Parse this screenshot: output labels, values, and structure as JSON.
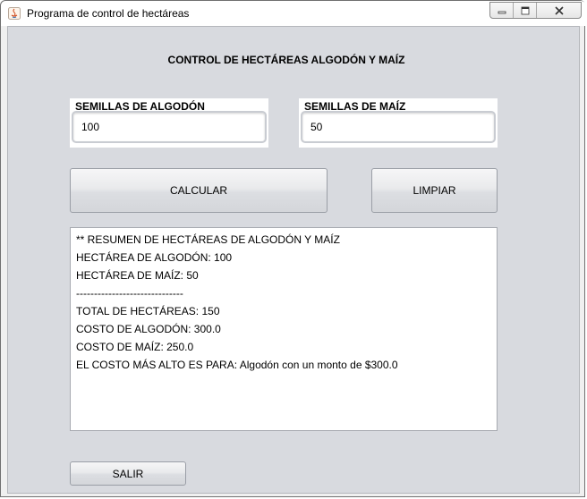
{
  "window": {
    "title": "Programa de control de hectáreas"
  },
  "heading": "CONTROL DE HECTÁREAS ALGODÓN Y MAÍZ",
  "fields": {
    "algodon": {
      "label": "SEMILLAS DE ALGODÓN",
      "value": "100"
    },
    "maiz": {
      "label": "SEMILLAS DE MAÍZ",
      "value": "50"
    }
  },
  "buttons": {
    "calcular": "CALCULAR",
    "limpiar": "LIMPIAR",
    "salir": "SALIR"
  },
  "output": {
    "lines": [
      "** RESUMEN DE HECTÁREAS DE ALGODÓN Y MAÍZ",
      "HECTÁREA DE ALGODÓN: 100",
      "HECTÁREA DE MAÍZ: 50",
      "------------------------------",
      "TOTAL DE HECTÁREAS: 150",
      "COSTO DE ALGODÓN: 300.0",
      "COSTO DE MAÍZ: 250.0",
      "EL COSTO MÁS ALTO ES PARA: Algodón con un monto de $300.0"
    ]
  }
}
